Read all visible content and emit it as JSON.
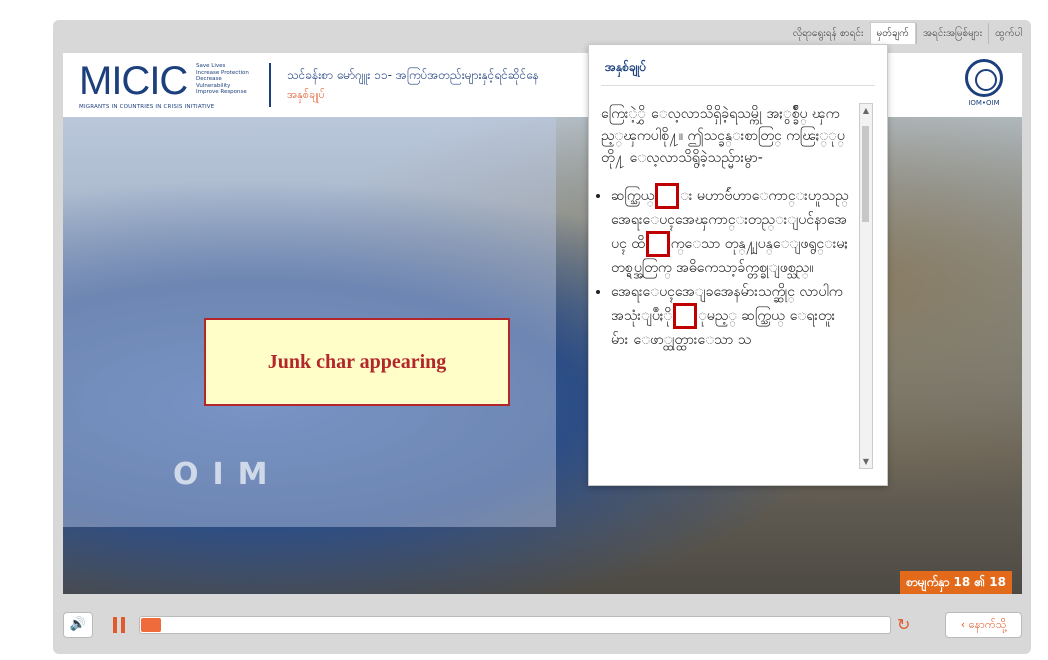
{
  "nav": {
    "tabs": [
      {
        "label": "လိုရာရွေးရန် စာရင်း",
        "active": false
      },
      {
        "label": "မှတ်ချက်",
        "active": true
      },
      {
        "label": "အရင်းအမြစ်များ",
        "active": false
      },
      {
        "label": "ထွက်ပါ",
        "active": false
      }
    ]
  },
  "header": {
    "logo_text": "MICIC",
    "logo_tag": "Save Lives\nIncrease Protection\nDecrease Vulnerability\nImprove Response",
    "logo_tagline": "MIGRANTS IN COUNTRIES IN CRISIS INITIATIVE",
    "course_title": "သင်ခန်းစာ မော်ဂျူး ၁၁- အကြပ်အတည်းများနှင့်ရင်ဆိုင်နေ",
    "course_subtitle": "အနှစ်ချုပ်",
    "partner_label": "IOM•OIM"
  },
  "slide": {
    "junk_label": "Junk char appearing",
    "counter": "စာမျက်နှာ 18 ၏ 18",
    "shirt_text_1": "I",
    "shirt_text_2": "OIM"
  },
  "popup": {
    "title": "အနှစ်ချုပ်",
    "intro": "ကြေးဲ့ွှိ ေလ့လာသိရှိခဲ့ရသမ္ကို အႏွစ္ခ်ဳပ္ ၾကည့္ၾကပါစို႔။ ဤသင္ခန္းစာတြင္ ကၽြႏ္ုပ္တို႔ ေလ့လာသိရွိခဲ့သည္မ်ားမွာ-",
    "bullet1_a": "ဆက္သြယ္",
    "bullet1_b": "း မဟာဗ်ဴဟာေကာင္းဟူသည္ အေရးေပၚအေၾကာင္းတည္းျပင်နာအေပၚ ထိ",
    "bullet1_c": "က္ေသာ တုန္႔ျပန္ေျဖရွင္းမႈ တစ္ရပ္အတြက္ အဓိကေသာ့ခ်က္တစ္ခုျဖစ္သည္။",
    "bullet2_a": "အေရးေပၚအေျခအေနမ်ားသက္ဆိုင္ လာပါက အသုံးျပဳႏို",
    "bullet2_b": "ုမည့္ ဆက္သြယ္ ေရးတူးမ်ား ေဖာ္ထုတ္ထားေသာ သ"
  },
  "player": {
    "progress_fraction": 0.02,
    "back_label": "‹ နောက်သို့"
  },
  "colors": {
    "accent": "#e05a2b",
    "brand_blue": "#1c3f7d",
    "highlight_red": "#c00000",
    "note_bg": "#fffec8"
  }
}
